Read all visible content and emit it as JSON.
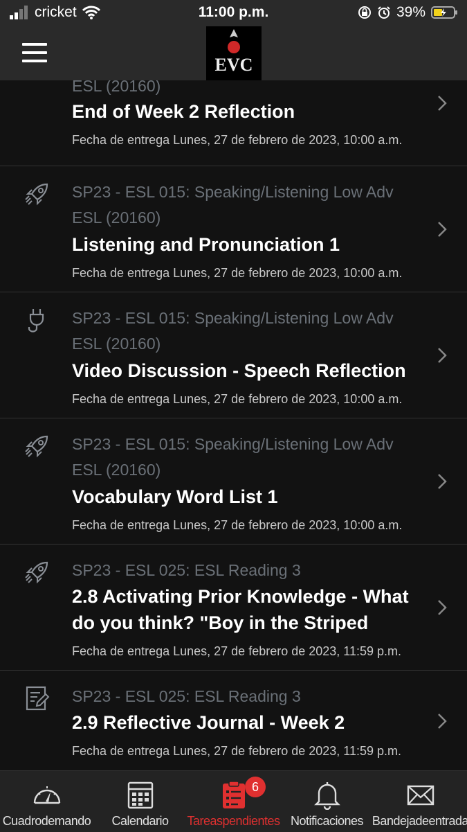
{
  "status_bar": {
    "carrier": "cricket",
    "time": "11:00 p.m.",
    "battery": "39%"
  },
  "header": {
    "logo_text": "EVC"
  },
  "assignments": [
    {
      "icon": "none",
      "course_lines": [
        "ESL (20160)"
      ],
      "title_lines": [
        "End of Week 2 Reflection"
      ],
      "due": "Fecha de entrega Lunes, 27 de febrero de 2023, 10:00 a.m."
    },
    {
      "icon": "rocket-icon",
      "course_lines": [
        "SP23 - ESL 015: Speaking/Listening Low Adv",
        "ESL (20160)"
      ],
      "title_lines": [
        "Listening and Pronunciation 1"
      ],
      "due": "Fecha de entrega Lunes, 27 de febrero de 2023, 10:00 a.m."
    },
    {
      "icon": "plug-icon",
      "course_lines": [
        "SP23 - ESL 015: Speaking/Listening Low Adv",
        "ESL (20160)"
      ],
      "title_lines": [
        "Video Discussion - Speech Reflection"
      ],
      "due": "Fecha de entrega Lunes, 27 de febrero de 2023, 10:00 a.m."
    },
    {
      "icon": "rocket-icon",
      "course_lines": [
        "SP23 - ESL 015: Speaking/Listening Low Adv",
        "ESL (20160)"
      ],
      "title_lines": [
        "Vocabulary Word List 1"
      ],
      "due": "Fecha de entrega Lunes, 27 de febrero de 2023, 10:00 a.m."
    },
    {
      "icon": "rocket-icon",
      "course_lines": [
        "SP23 - ESL 025: ESL Reading 3"
      ],
      "title_lines": [
        "2.8 Activating Prior Knowledge - What",
        "do you think? \"Boy in the Striped"
      ],
      "due": "Fecha de entrega Lunes, 27 de febrero de 2023, 11:59 p.m."
    },
    {
      "icon": "journal-icon",
      "course_lines": [
        "SP23 - ESL 025: ESL Reading 3"
      ],
      "title_lines": [
        "2.9 Reflective Journal - Week 2"
      ],
      "due": "Fecha de entrega Lunes, 27 de febrero de 2023, 11:59 p.m."
    }
  ],
  "tab_bar": {
    "tabs": [
      {
        "label": "Cuadrodemando",
        "icon": "dashboard-icon",
        "active": false
      },
      {
        "label": "Calendario",
        "icon": "calendar-icon",
        "active": false
      },
      {
        "label": "Tareaspendientes",
        "icon": "clipboard-icon",
        "active": true,
        "badge": "6"
      },
      {
        "label": "Notificaciones",
        "icon": "bell-icon",
        "active": false
      },
      {
        "label": "Bandejadeentrada",
        "icon": "mail-icon",
        "active": false
      }
    ]
  },
  "colors": {
    "accent": "#e03030",
    "course_text": "#6a7077",
    "background": "#121212"
  }
}
